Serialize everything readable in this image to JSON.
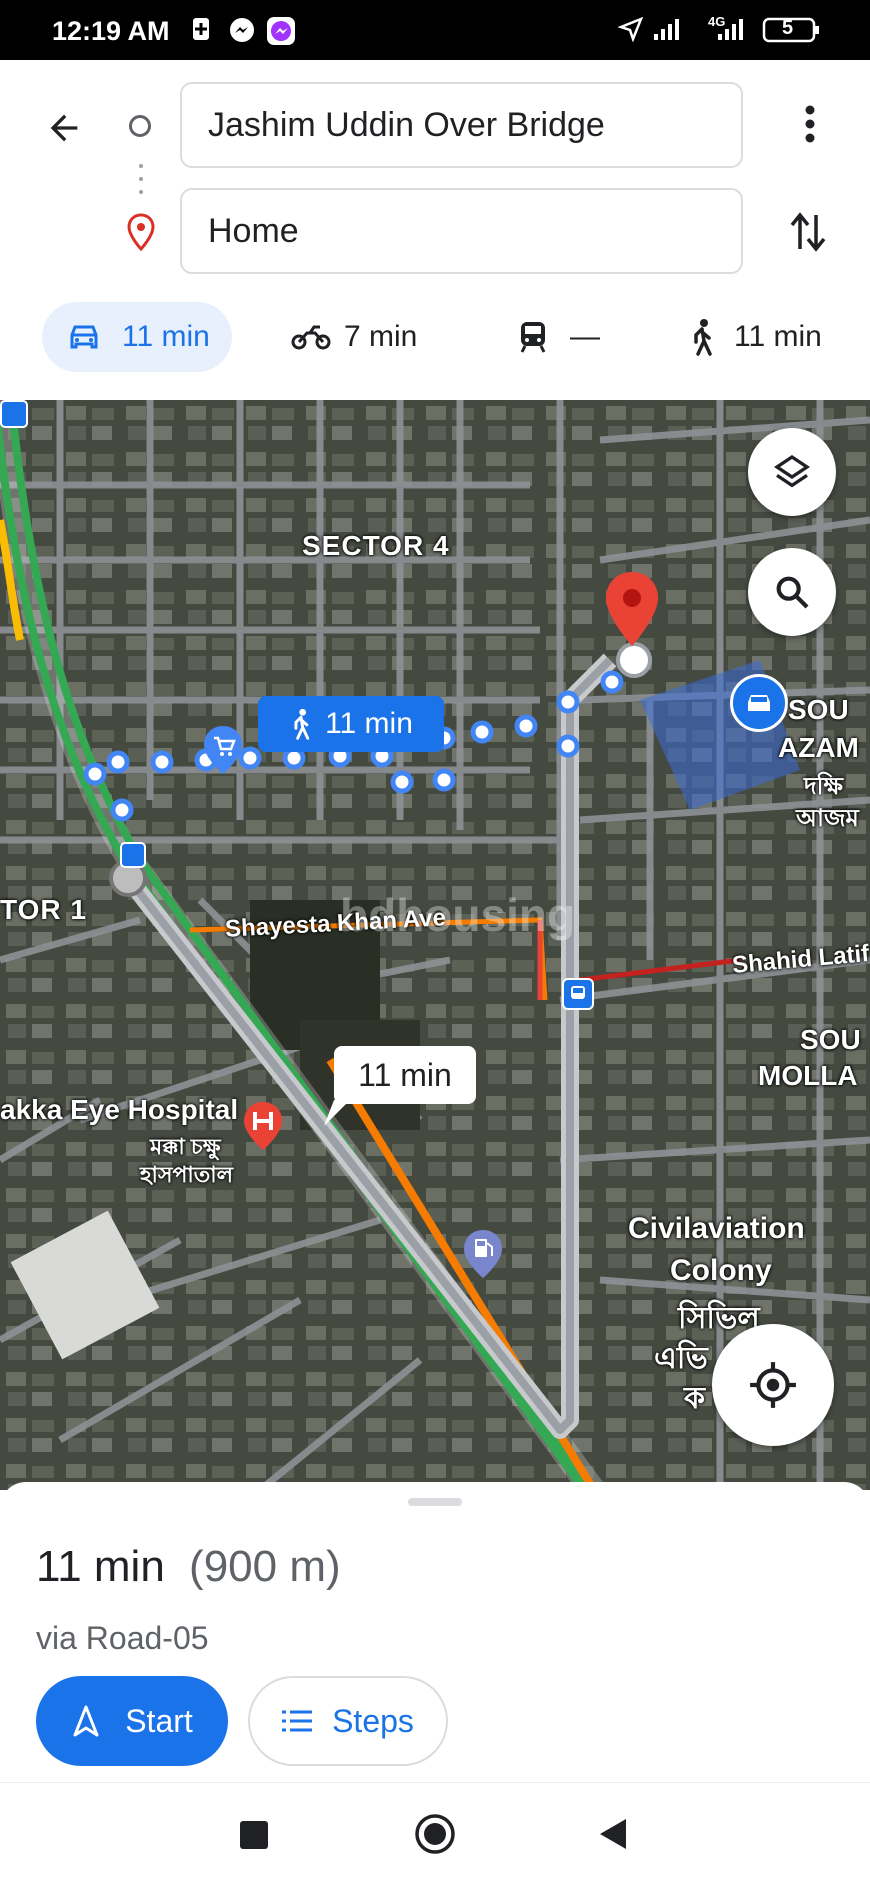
{
  "status_bar": {
    "time": "12:19 AM",
    "network": "4G",
    "battery": "5"
  },
  "directions": {
    "origin_value": "Jashim Uddin Over Bridge",
    "destination_value": "Home"
  },
  "travel_modes": [
    {
      "mode": "drive",
      "label": "11 min",
      "active": true
    },
    {
      "mode": "motorcycle",
      "label": "7 min"
    },
    {
      "mode": "transit",
      "label": "—"
    },
    {
      "mode": "walk",
      "label": "11 min"
    }
  ],
  "map": {
    "labels": {
      "sector4": "SECTOR 4",
      "sector1": "TOR 1",
      "shayesta": "Shayesta Khan Ave",
      "shahid": "Shahid Latif",
      "hospital_en": "akka Eye Hospital",
      "hospital_bn1": "মক্কা চক্ষু",
      "hospital_bn2": "হাসপাতাল",
      "civil1": "Civilaviation",
      "civil2": "Colony",
      "civil3": "সিভিল",
      "civil4": "এভি",
      "civil5": "ক",
      "sou1": "SOU",
      "azam": "AZAM",
      "dokkhin": "দক্ষি",
      "azam_bn": "আজম",
      "sou2": "SOU",
      "molla": "MOLLA",
      "watermark": "bdhousing"
    },
    "walk_callout": "11 min",
    "drive_callout": "11 min"
  },
  "summary": {
    "duration": "11 min",
    "distance": "(900 m)",
    "via": "via Road-05",
    "start_label": "Start",
    "steps_label": "Steps"
  },
  "colors": {
    "accent": "#1a73e8",
    "map_bg": "#3e4239",
    "traffic_green": "#34a853",
    "traffic_orange": "#f57c00",
    "pin_red": "#ea4335"
  }
}
